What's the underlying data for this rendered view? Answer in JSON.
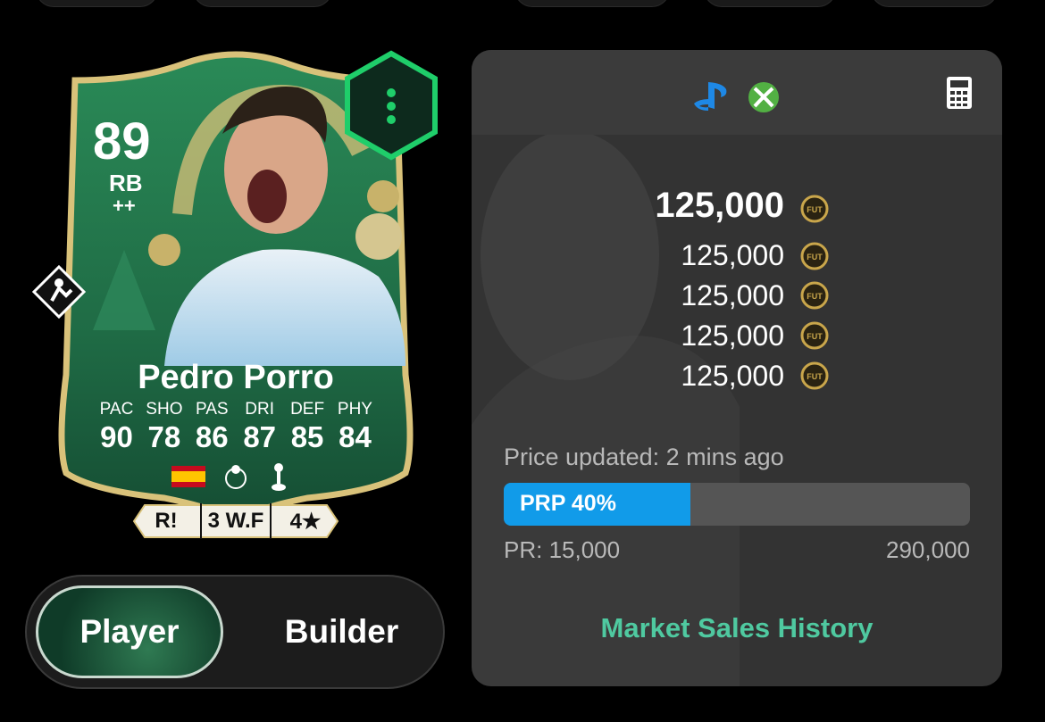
{
  "card": {
    "rating": "89",
    "position": "RB",
    "position_plus": "++",
    "name": "Pedro Porro",
    "stat_labels": [
      "PAC",
      "SHO",
      "PAS",
      "DRI",
      "DEF",
      "PHY"
    ],
    "stat_values": [
      "90",
      "78",
      "86",
      "87",
      "85",
      "84"
    ],
    "badges": [
      "R!",
      "3 W.F",
      "4★"
    ],
    "icons": [
      "spain-flag-icon",
      "premier-league-icon",
      "tottenham-crest-icon",
      "playstyle-icon",
      "menu-dots-icon"
    ]
  },
  "toggle": {
    "player": "Player",
    "builder": "Builder"
  },
  "panel": {
    "platform_icons": [
      "playstation-icon",
      "xbox-icon"
    ],
    "calculator_icon": "calculator-icon",
    "price_main": "125,000",
    "prices": [
      "125,000",
      "125,000",
      "125,000",
      "125,000"
    ],
    "coin_label": "FUT",
    "updated": "Price updated: 2 mins ago",
    "prp_label": "PRP 40%",
    "prp_percent": 40,
    "pr_min": "PR: 15,000",
    "pr_max": "290,000",
    "history_link": "Market Sales History"
  },
  "colors": {
    "accent_blue": "#119be9",
    "link_green": "#4fc9a0",
    "card_green": "#1f6b45",
    "gold": "#d9c27a"
  }
}
